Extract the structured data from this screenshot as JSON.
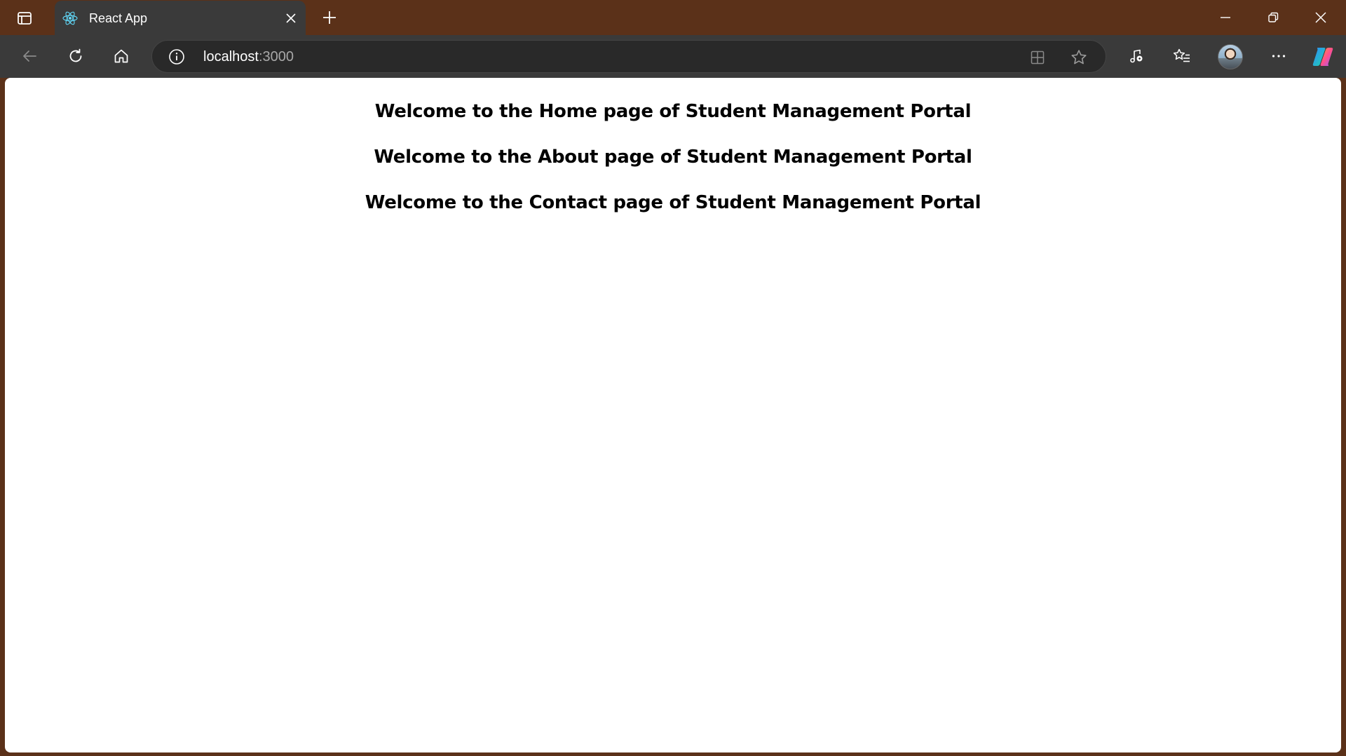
{
  "browser": {
    "tab": {
      "title": "React App"
    },
    "address": {
      "host": "localhost",
      "port": ":3000"
    }
  },
  "icons": {
    "tab_actions": "tab-actions-icon",
    "favicon": "react-logo-icon",
    "tab_close": "close-icon",
    "new_tab": "plus-icon",
    "minimize": "minimize-icon",
    "restore": "restore-icon",
    "close_window": "close-icon",
    "back": "arrow-left-icon",
    "refresh": "refresh-icon",
    "home": "home-icon",
    "site_info": "info-icon",
    "app_available": "apps-icon",
    "favorite": "star-icon",
    "media": "music-note-icon",
    "favorites": "favorites-list-icon",
    "more": "more-icon",
    "copilot": "copilot-icon"
  },
  "colors": {
    "titlebar": "#5b3119",
    "toolbar": "#3a3a3a",
    "addressbar": "#292929",
    "page_background": "#ffffff",
    "react_accent": "#61dafb"
  },
  "page": {
    "headings": [
      "Welcome to the Home page of Student Management Portal",
      "Welcome to the About page of Student Management Portal",
      "Welcome to the Contact page of Student Management Portal"
    ]
  }
}
